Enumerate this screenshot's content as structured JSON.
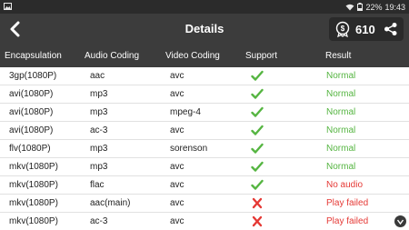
{
  "status_bar": {
    "battery": "22%",
    "time": "19:43"
  },
  "app_bar": {
    "title": "Details",
    "coin_count": "610"
  },
  "table": {
    "headers": [
      "Encapsulation",
      "Audio Coding",
      "Video Coding",
      "Support",
      "Result"
    ],
    "rows": [
      {
        "encapsulation": "3gp(1080P)",
        "audio": "aac",
        "video": "avc",
        "support": "check",
        "result": "Normal"
      },
      {
        "encapsulation": "avi(1080P)",
        "audio": "mp3",
        "video": "avc",
        "support": "check",
        "result": "Normal"
      },
      {
        "encapsulation": "avi(1080P)",
        "audio": "mp3",
        "video": "mpeg-4",
        "support": "check",
        "result": "Normal"
      },
      {
        "encapsulation": "avi(1080P)",
        "audio": "ac-3",
        "video": "avc",
        "support": "check",
        "result": "Normal"
      },
      {
        "encapsulation": "flv(1080P)",
        "audio": "mp3",
        "video": "sorenson",
        "support": "check",
        "result": "Normal"
      },
      {
        "encapsulation": "mkv(1080P)",
        "audio": "mp3",
        "video": "avc",
        "support": "check",
        "result": "Normal"
      },
      {
        "encapsulation": "mkv(1080P)",
        "audio": "flac",
        "video": "avc",
        "support": "check",
        "result": "No audio"
      },
      {
        "encapsulation": "mkv(1080P)",
        "audio": "aac(main)",
        "video": "avc",
        "support": "cross",
        "result": "Play failed"
      },
      {
        "encapsulation": "mkv(1080P)",
        "audio": "ac-3",
        "video": "avc",
        "support": "cross",
        "result": "Play failed"
      }
    ]
  },
  "colors": {
    "ok": "#55b541",
    "bad": "#e53935",
    "header_bg": "#3c3c3c"
  },
  "icons": [
    "back-arrow-icon",
    "coin-icon",
    "share-icon",
    "check-icon",
    "cross-icon",
    "scroll-down-icon",
    "image-icon",
    "battery-icon",
    "wifi-icon"
  ]
}
